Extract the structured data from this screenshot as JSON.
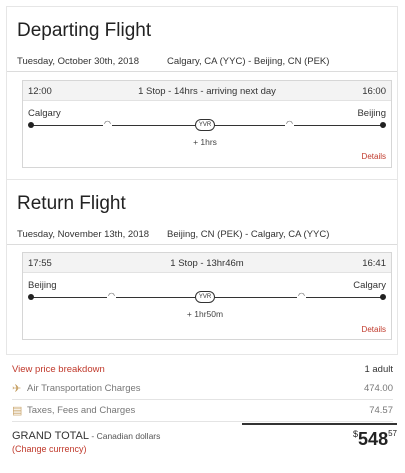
{
  "departing": {
    "title": "Departing Flight",
    "date": "Tuesday, October 30th, 2018",
    "route": "Calgary, CA (YYC) - Beijing, CN (PEK)",
    "depart_time": "12:00",
    "stops_summary": "1 Stop - 14hrs - arriving next day",
    "arrive_time": "16:00",
    "origin": "Calgary",
    "destination": "Beijing",
    "stop_code": "YVR",
    "layover": "+ 1hrs",
    "details_label": "Details"
  },
  "return": {
    "title": "Return Flight",
    "date": "Tuesday, November 13th, 2018",
    "route": "Beijing, CN (PEK) - Calgary, CA (YYC)",
    "depart_time": "17:55",
    "stops_summary": "1 Stop - 13hr46m",
    "arrive_time": "16:41",
    "origin": "Beijing",
    "destination": "Calgary",
    "stop_code": "YVR",
    "layover": "+ 1hr50m",
    "details_label": "Details"
  },
  "breakdown": {
    "link_label": "View price breakdown",
    "passengers": "1 adult",
    "rows": [
      {
        "label": "Air Transportation Charges",
        "value": "474.00",
        "icon": "plane-icon"
      },
      {
        "label": "Taxes, Fees and Charges",
        "value": "74.57",
        "icon": "taxes-icon"
      }
    ]
  },
  "total": {
    "label": "GRAND TOTAL",
    "sublabel": " - Canadian dollars",
    "change_currency": "(Change currency)",
    "currency_symbol": "$",
    "amount": "548",
    "cents": "57"
  },
  "colors": {
    "accent": "#c0392b",
    "icon_gold": "#c9a46a"
  }
}
